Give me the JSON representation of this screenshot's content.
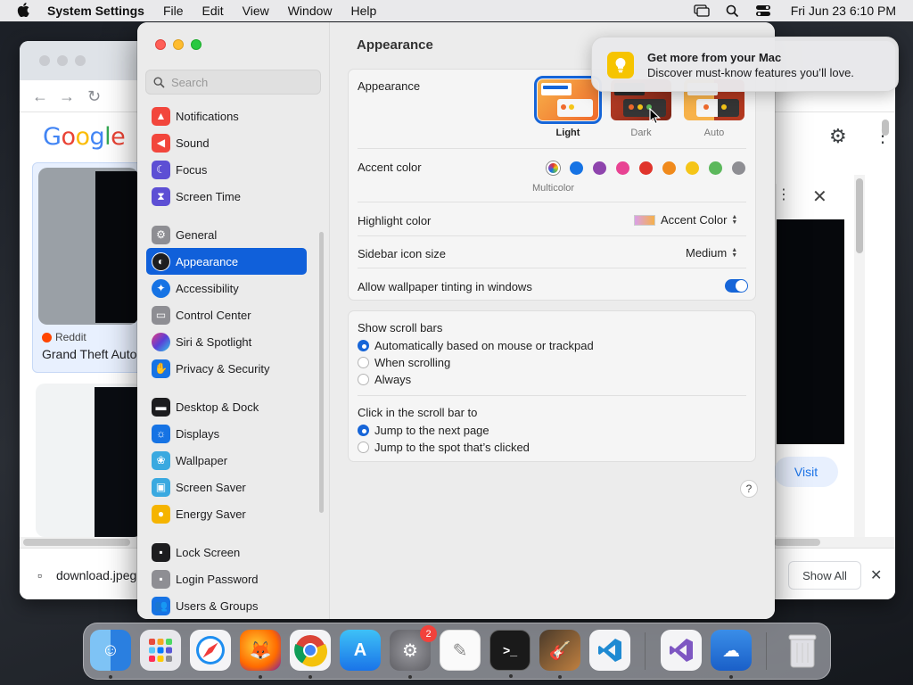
{
  "menubar": {
    "app_name": "System Settings",
    "menus": [
      "File",
      "Edit",
      "View",
      "Window",
      "Help"
    ],
    "clock": "Fri Jun 23  6:10 PM"
  },
  "chrome_bg": {
    "google_logo": "Google",
    "card_source": "Reddit",
    "card_title": "Grand Theft Auto",
    "visit_label": "Visit",
    "download_file": "download.jpeg",
    "show_all_label": "Show All"
  },
  "sidebar": {
    "search_placeholder": "Search",
    "items": [
      {
        "label": "Notifications",
        "icon": "bell-icon",
        "color": "#f2463c"
      },
      {
        "label": "Sound",
        "icon": "speaker-icon",
        "color": "#f2463c"
      },
      {
        "label": "Focus",
        "icon": "moon-icon",
        "color": "#5d4fd4"
      },
      {
        "label": "Screen Time",
        "icon": "hourglass-icon",
        "color": "#5d4fd4"
      },
      {
        "label": "General",
        "icon": "gear-icon",
        "color": "#8e8e93"
      },
      {
        "label": "Appearance",
        "icon": "appearance-icon",
        "color": "#1d1d1f"
      },
      {
        "label": "Accessibility",
        "icon": "accessibility-icon",
        "color": "#1673e4"
      },
      {
        "label": "Control Center",
        "icon": "control-center-icon",
        "color": "#8e8e93"
      },
      {
        "label": "Siri & Spotlight",
        "icon": "siri-icon",
        "color": "#7b3fd6"
      },
      {
        "label": "Privacy & Security",
        "icon": "hand-icon",
        "color": "#1673e4"
      },
      {
        "label": "Desktop & Dock",
        "icon": "dock-icon",
        "color": "#1d1d1f"
      },
      {
        "label": "Displays",
        "icon": "sun-icon",
        "color": "#1673e4"
      },
      {
        "label": "Wallpaper",
        "icon": "flower-icon",
        "color": "#3aa9e0"
      },
      {
        "label": "Screen Saver",
        "icon": "screen-saver-icon",
        "color": "#3aa9e0"
      },
      {
        "label": "Energy Saver",
        "icon": "bulb-icon",
        "color": "#f5b400"
      },
      {
        "label": "Lock Screen",
        "icon": "lock-icon",
        "color": "#1d1d1f"
      },
      {
        "label": "Login Password",
        "icon": "lock-icon",
        "color": "#8e8e93"
      },
      {
        "label": "Users & Groups",
        "icon": "users-icon",
        "color": "#1673e4"
      }
    ],
    "selected": "Appearance"
  },
  "main": {
    "title": "Appearance",
    "appearance_label": "Appearance",
    "appearance_options": [
      {
        "label": "Light",
        "selected": true
      },
      {
        "label": "Dark",
        "selected": false
      },
      {
        "label": "Auto",
        "selected": false
      }
    ],
    "accent_label": "Accent color",
    "accent_colors": [
      "multicolor",
      "#1673e4",
      "#8e44ad",
      "#e84393",
      "#e0342c",
      "#f08a1c",
      "#f5c518",
      "#5cb85c",
      "#8e8e93"
    ],
    "accent_selected_label": "Multicolor",
    "highlight_label": "Highlight color",
    "highlight_value": "Accent Color",
    "sidebar_icon_label": "Sidebar icon size",
    "sidebar_icon_value": "Medium",
    "wallpaper_tint_label": "Allow wallpaper tinting in windows",
    "wallpaper_tint_on": true,
    "scroll_bars_label": "Show scroll bars",
    "scroll_bar_options": [
      "Automatically based on mouse or trackpad",
      "When scrolling",
      "Always"
    ],
    "click_label": "Click in the scroll bar to",
    "click_options": [
      "Jump to the next page",
      "Jump to the spot that’s clicked"
    ],
    "help_label": "?"
  },
  "notification": {
    "title": "Get more from your Mac",
    "body": "Discover must-know features you’ll love."
  },
  "dock": {
    "items": [
      "Finder",
      "Launchpad",
      "Safari",
      "Firefox",
      "Chrome",
      "App Store",
      "System Settings",
      "TextEdit",
      "Terminal",
      "GarageBand",
      "VS Code",
      "Visual Studio",
      "Weather",
      "Trash"
    ],
    "settings_badge": "2"
  }
}
